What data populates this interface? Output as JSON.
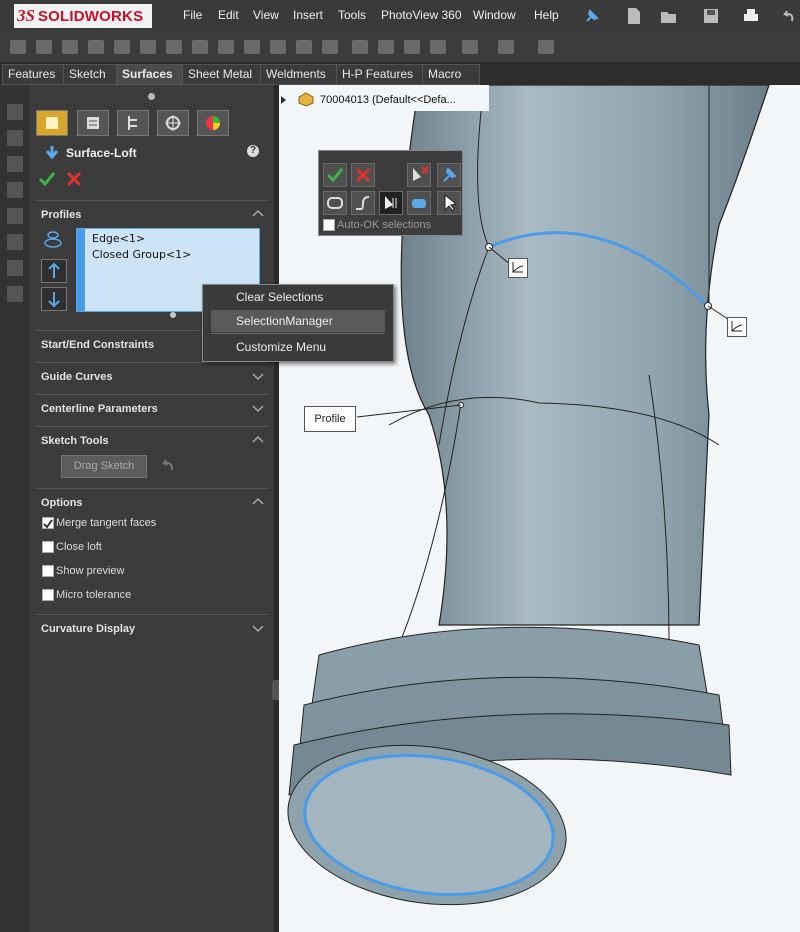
{
  "app": {
    "logo_ds": "3S",
    "logo_text": "SOLIDWORKS"
  },
  "menu": [
    "File",
    "Edit",
    "View",
    "Insert",
    "Tools",
    "PhotoView 360",
    "Window",
    "Help"
  ],
  "tabs": [
    "Features",
    "Sketch",
    "Surfaces",
    "Sheet Metal",
    "Weldments",
    "H-P Features",
    "Macro"
  ],
  "active_tab": "Surfaces",
  "tree": {
    "part_label": "70004013  (Default<<Defa..."
  },
  "panel": {
    "title": "Surface-Loft",
    "help": "?",
    "profiles": {
      "title": "Profiles",
      "items": [
        "Edge<1>",
        "Closed Group<1>"
      ]
    },
    "sections": {
      "start_end": "Start/End Constraints",
      "guide": "Guide Curves",
      "centerline": "Centerline Parameters",
      "sketch_tools": "Sketch Tools",
      "drag_sketch": "Drag Sketch",
      "options": "Options",
      "curvature": "Curvature Display"
    },
    "options": [
      {
        "label": "Merge tangent faces",
        "checked": true
      },
      {
        "label": "Close loft",
        "checked": false
      },
      {
        "label": "Show preview",
        "checked": false
      },
      {
        "label": "Micro tolerance",
        "checked": false
      }
    ]
  },
  "context_menu": [
    "Clear Selections",
    "SelectionManager",
    "Customize Menu"
  ],
  "selection_toolbar": {
    "auto_ok": "Auto-OK selections"
  },
  "callouts": {
    "profile": "Profile"
  },
  "colors": {
    "accent_blue": "#4a9be8",
    "ok_green": "#3bb54a",
    "cancel_red": "#e0332f",
    "model": "#8fa3ae"
  }
}
